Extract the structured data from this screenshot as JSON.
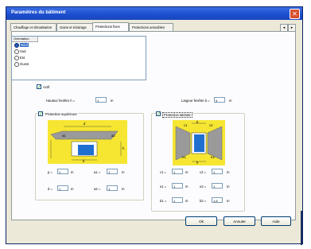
{
  "window": {
    "title": "Paramètres du bâtiment",
    "close_symbol": "✕"
  },
  "tabs": [
    {
      "label": "Chauffage et climatisation",
      "active": false
    },
    {
      "label": "Gains et éclairage",
      "active": false
    },
    {
      "label": "Protections fixes",
      "active": true
    },
    {
      "label": "Protections amovibles",
      "active": false
    }
  ],
  "tab_scroll": {
    "left": "◂",
    "right": "▸"
  },
  "orientation_list": {
    "header": "Orientation",
    "items": [
      {
        "label": "Nord",
        "selected": true
      },
      {
        "label": "Sud",
        "selected": false
      },
      {
        "label": "Est",
        "selected": false
      },
      {
        "label": "Ouest",
        "selected": false
      }
    ]
  },
  "actif": {
    "label": "Actif",
    "checked": true
  },
  "window_dims": {
    "height_label": "Hauteur fenêtre h =",
    "height_value": "1",
    "height_unit": "m",
    "width_label": "Largeur fenêtre b =",
    "width_value": "4",
    "width_unit": "m"
  },
  "protection_superieure": {
    "label": "Protection supérieure",
    "checked": true,
    "diagram_labels": {
      "d": "d",
      "a1": "a1",
      "a2": "a2",
      "b": "b",
      "h": "h"
    },
    "fields": [
      {
        "label": "p =",
        "value": "1",
        "unit": "m"
      },
      {
        "label": "a1 =",
        "value": "1",
        "unit": "m"
      },
      {
        "label": "d =",
        "value": "1",
        "unit": "m"
      },
      {
        "label": "a2 =",
        "value": "1",
        "unit": "m"
      }
    ]
  },
  "protection_laterale": {
    "label": "Protection latérale",
    "checked": true,
    "diagram_labels": {
      "c1": "c1",
      "c2": "c2",
      "e1": "e1",
      "e2": "e2",
      "h": "h",
      "b": "b"
    },
    "fields": [
      {
        "label": "c1 =",
        "value": "1",
        "unit": "m"
      },
      {
        "label": "c2 =",
        "value": "1",
        "unit": "m"
      },
      {
        "label": "e1 =",
        "value": "1",
        "unit": "m"
      },
      {
        "label": "e2 =",
        "value": "1",
        "unit": "m"
      },
      {
        "label": "b1 =",
        "value": "1",
        "unit": "m"
      },
      {
        "label": "b2 =",
        "value": "1,5",
        "unit": "m"
      }
    ]
  },
  "buttons": {
    "ok": "Ok",
    "cancel": "Annuler",
    "help": "Aide"
  },
  "colors": {
    "title_bar": "#1d4fcf",
    "scheme_bg": "#f6e632",
    "window_blue": "#1f6fd0",
    "grey_shade": "#9a9a9a"
  }
}
